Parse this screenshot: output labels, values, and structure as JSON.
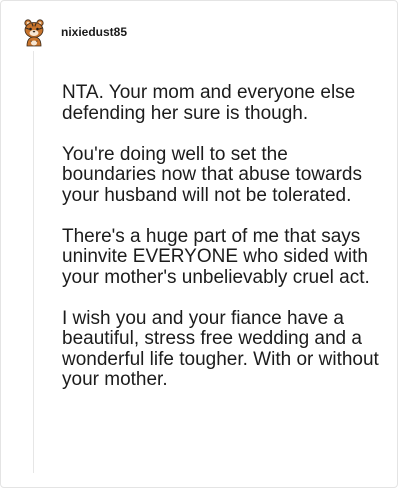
{
  "comment": {
    "username": "nixiedust85",
    "avatar_icon": "reddit-snoo-tiger-avatar-icon",
    "paragraphs": [
      "NTA. Your mom and everyone else defending her sure is though.",
      "You're doing well to set the boundaries now that abuse towards your husband will not be tolerated.",
      "There's a huge part of me that says uninvite EVERYONE who sided with your mother's unbelievably cruel act.",
      "I wish you and your fiance have a beautiful, stress free wedding and a wonderful life tougher. With or without your mother."
    ]
  },
  "colors": {
    "text": "#1c1c1c",
    "border": "#e4e4e4",
    "avatar_fur": "#c8742c",
    "avatar_stripes": "#3a2a1c"
  }
}
